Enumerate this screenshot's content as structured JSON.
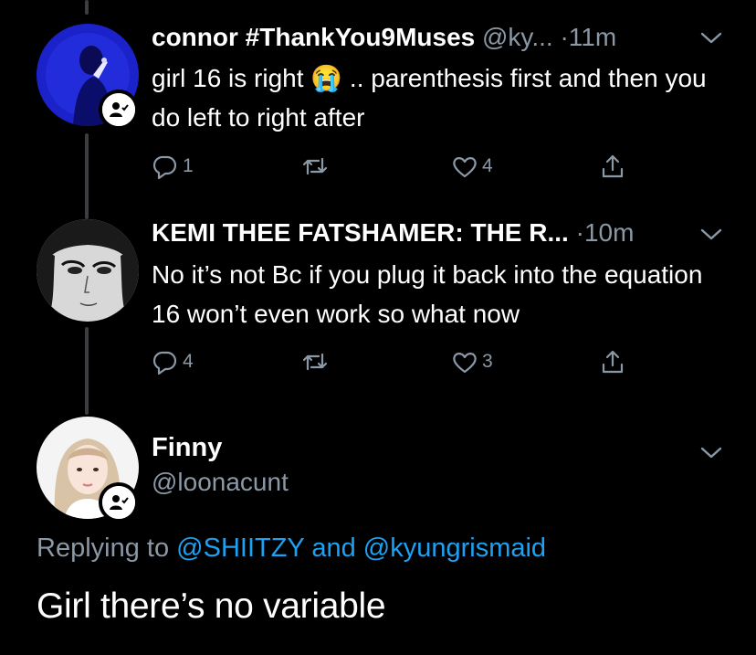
{
  "colors": {
    "background": "#000000",
    "secondary_text": "#8b98a5",
    "link": "#1da1f2",
    "thread_line": "#3a3d41"
  },
  "tweets": [
    {
      "name": "connor #ThankYou9Muses",
      "handle": "@ky...",
      "dot": "·",
      "time": "11m",
      "text": "girl 16 is right 😭 .. parenthesis first and then you do left to right after",
      "reply_count": "1",
      "retweet_count": "",
      "like_count": "4",
      "verified_badge_icon": "follow-request-icon"
    },
    {
      "name": "KEMI THEE FATSHAMER: THE R...",
      "handle": "",
      "dot": "·",
      "time": "10m",
      "text": "No it’s not Bc if you plug it back into the equation 16 won’t even work so what now",
      "reply_count": "4",
      "retweet_count": "",
      "like_count": "3"
    }
  ],
  "main_tweet": {
    "name": "Finny",
    "handle": "@loonacunt",
    "replying_prefix": "Replying to",
    "replying_user1": "@SHIITZY",
    "replying_and": "and",
    "replying_user2": "@kyungrismaid",
    "text": "Girl there’s no variable"
  },
  "icons": [
    "reply-icon",
    "retweet-icon",
    "like-icon",
    "share-icon",
    "chevron-down-icon",
    "follow-request-icon"
  ]
}
